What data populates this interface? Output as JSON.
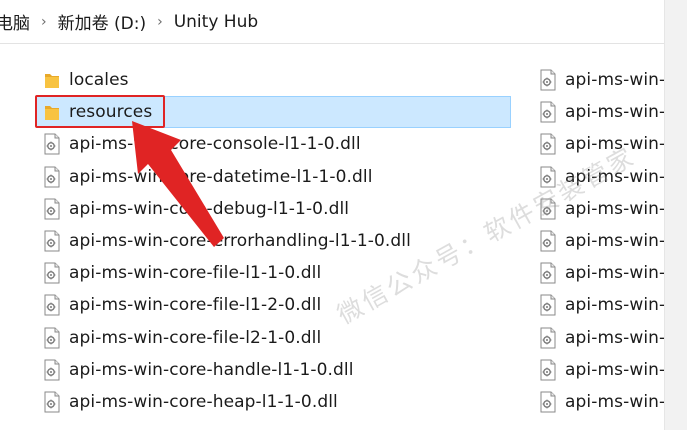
{
  "breadcrumb": {
    "items": [
      "电脑",
      "新加卷 (D:)",
      "Unity Hub"
    ]
  },
  "files_left": [
    {
      "name": "locales",
      "type": "folder"
    },
    {
      "name": "resources",
      "type": "folder",
      "selected": true
    },
    {
      "name": "api-ms-win-core-console-l1-1-0.dll",
      "type": "dll"
    },
    {
      "name": "api-ms-win-core-datetime-l1-1-0.dll",
      "type": "dll"
    },
    {
      "name": "api-ms-win-core-debug-l1-1-0.dll",
      "type": "dll"
    },
    {
      "name": "api-ms-win-core-errorhandling-l1-1-0.dll",
      "type": "dll"
    },
    {
      "name": "api-ms-win-core-file-l1-1-0.dll",
      "type": "dll"
    },
    {
      "name": "api-ms-win-core-file-l1-2-0.dll",
      "type": "dll"
    },
    {
      "name": "api-ms-win-core-file-l2-1-0.dll",
      "type": "dll"
    },
    {
      "name": "api-ms-win-core-handle-l1-1-0.dll",
      "type": "dll"
    },
    {
      "name": "api-ms-win-core-heap-l1-1-0.dll",
      "type": "dll"
    }
  ],
  "files_right": [
    {
      "name": "api-ms-win-",
      "type": "dll"
    },
    {
      "name": "api-ms-win-",
      "type": "dll"
    },
    {
      "name": "api-ms-win-",
      "type": "dll"
    },
    {
      "name": "api-ms-win-",
      "type": "dll"
    },
    {
      "name": "api-ms-win-",
      "type": "dll"
    },
    {
      "name": "api-ms-win-",
      "type": "dll"
    },
    {
      "name": "api-ms-win-",
      "type": "dll"
    },
    {
      "name": "api-ms-win-",
      "type": "dll"
    },
    {
      "name": "api-ms-win-",
      "type": "dll"
    },
    {
      "name": "api-ms-win-",
      "type": "dll"
    },
    {
      "name": "api-ms-win-",
      "type": "dll"
    }
  ],
  "watermark": "微信公众号：软件安装管家",
  "colors": {
    "selection_bg": "#cce8ff",
    "selection_border": "#99d1ff",
    "annotation_red": "#e02424",
    "folder_yellow": "#f8c341"
  }
}
